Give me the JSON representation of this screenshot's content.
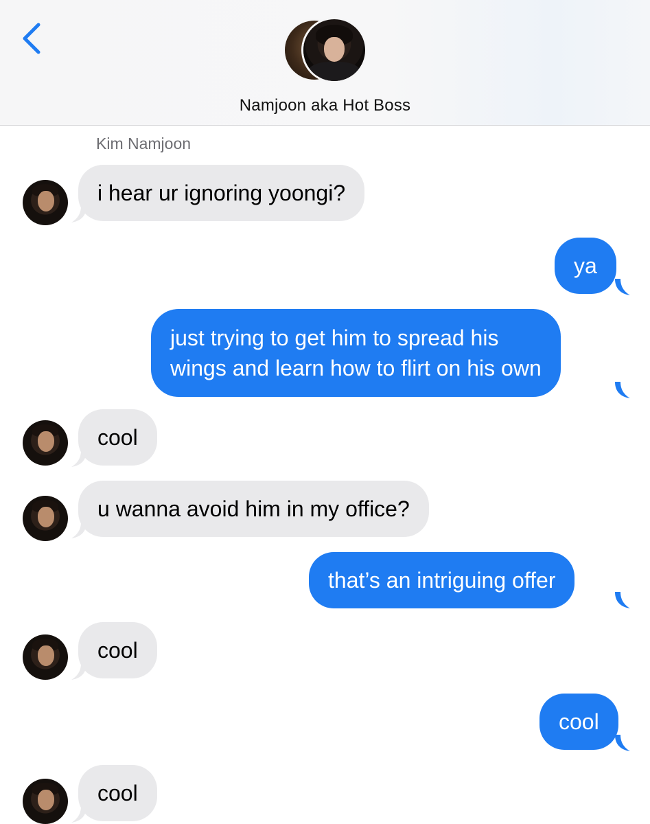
{
  "header": {
    "contact_name": "Namjoon aka Hot Boss"
  },
  "thread": {
    "sender_label": "Kim Namjoon",
    "messages": [
      {
        "from": "them",
        "text": "i hear ur ignoring yoongi?"
      },
      {
        "from": "me",
        "text": "ya"
      },
      {
        "from": "me",
        "lines": [
          "just trying to get him to spread his",
          "wings and learn how to flirt on his own"
        ]
      },
      {
        "from": "them",
        "text": "cool"
      },
      {
        "from": "them",
        "text": "u wanna avoid him in my office?"
      },
      {
        "from": "me",
        "text": "that’s an intriguing offer"
      },
      {
        "from": "them",
        "text": "cool"
      },
      {
        "from": "me",
        "text": "cool"
      },
      {
        "from": "them",
        "text": "cool"
      }
    ]
  },
  "colors": {
    "incoming_bubble": "#e9e9eb",
    "outgoing_bubble": "#1f7cf2",
    "back_chevron": "#1f7cf2"
  },
  "icons": {
    "back": "chevron-left-icon",
    "contact_avatar": "avatar",
    "message_avatar": "avatar"
  }
}
